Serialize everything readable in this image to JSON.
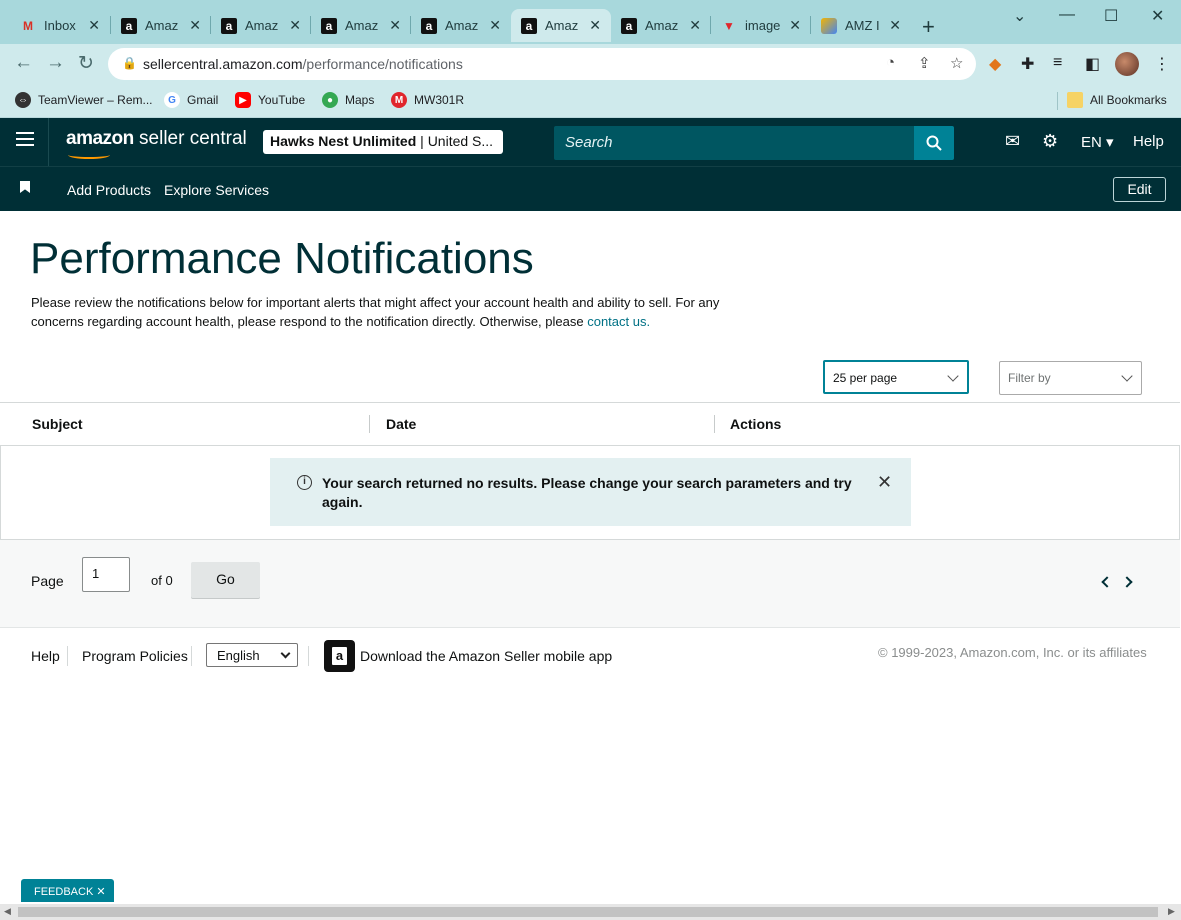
{
  "browser": {
    "tabs": [
      {
        "title": "Inbox",
        "icon": "gmail-icon"
      },
      {
        "title": "Amaz",
        "icon": "amazon-icon"
      },
      {
        "title": "Amaz",
        "icon": "amazon-icon"
      },
      {
        "title": "Amaz",
        "icon": "amazon-icon"
      },
      {
        "title": "Amaz",
        "icon": "amazon-icon"
      },
      {
        "title": "Amaz",
        "icon": "amazon-icon"
      },
      {
        "title": "Amaz",
        "icon": "amazon-icon"
      },
      {
        "title": "image",
        "icon": "vivaldi-icon"
      },
      {
        "title": "AMZ I",
        "icon": "amz-tool-icon"
      }
    ],
    "active_tab_index": 5,
    "url_host": "sellercentral.amazon.com",
    "url_path": "/performance/notifications",
    "bookmarks": [
      {
        "label": "TeamViewer – Rem...",
        "icon": "teamviewer-icon"
      },
      {
        "label": "Gmail",
        "icon": "google-icon"
      },
      {
        "label": "YouTube",
        "icon": "youtube-icon"
      },
      {
        "label": "Maps",
        "icon": "maps-icon"
      },
      {
        "label": "MW301R",
        "icon": "mercusys-icon"
      }
    ],
    "all_bookmarks": "All Bookmarks"
  },
  "header": {
    "logo_brand": "amazon",
    "logo_product": "seller central",
    "store_name": "Hawks Nest Unlimited",
    "store_region": "United S...",
    "search_placeholder": "Search",
    "language": "EN",
    "help": "Help"
  },
  "nav": {
    "links": [
      "Add Products",
      "Explore Services"
    ],
    "edit": "Edit"
  },
  "main": {
    "title": "Performance Notifications",
    "intro": "Please review the notifications below for important alerts that might affect your account health and ability to sell. For any concerns regarding account health, please respond to the notification directly. Otherwise, please",
    "contact_link": "contact us.",
    "per_page": "25 per page",
    "filter_placeholder": "Filter by",
    "columns": [
      "Subject",
      "Date",
      "Actions"
    ],
    "empty_message": "Your search returned no results. Please change your search parameters and try again."
  },
  "pager": {
    "page_label": "Page",
    "page_value": "1",
    "of_label": "of 0",
    "go": "Go"
  },
  "footer": {
    "help": "Help",
    "program_policies": "Program Policies",
    "language": "English",
    "download_app": "Download the Amazon Seller mobile app",
    "copyright": "© 1999-2023, Amazon.com, Inc. or its affiliates"
  },
  "feedback": "FEEDBACK",
  "colors": {
    "header_bg": "#002f36",
    "accent": "#008296",
    "link": "#007185",
    "tabstrip": "#a8d8dc"
  }
}
